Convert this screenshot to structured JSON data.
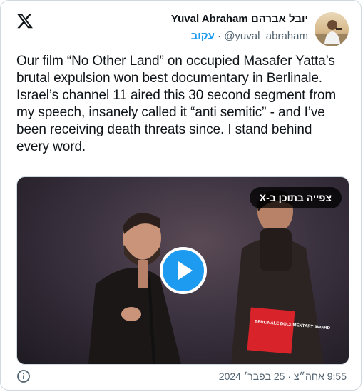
{
  "author": {
    "display_name": "Yuval Abraham יובל אברהם",
    "handle": "@yuval_abraham",
    "follow_label": "עקוב"
  },
  "tweet": {
    "text": "Our film “No Other Land” on occupied Masafer Yatta’s brutal expulsion won best documentary in Berlinale. Israel’s channel 11 aired this 30 second segment from my speech, insanely called it “anti semitic” - and I’ve been receiving death threats since. I stand behind every word.",
    "timestamp": "9:55 אחה״צ · 25 בפבר׳ 2024"
  },
  "media": {
    "watch_label": "צפייה בתוכן ב-X",
    "sign_text": "BERLINALE DOCUMENTARY AWARD"
  },
  "icons": {
    "logo": "x-logo-icon",
    "play": "play-icon",
    "info": "info-icon"
  },
  "colors": {
    "accent": "#1d9bf0",
    "text": "#0f1419",
    "muted": "#536471"
  }
}
